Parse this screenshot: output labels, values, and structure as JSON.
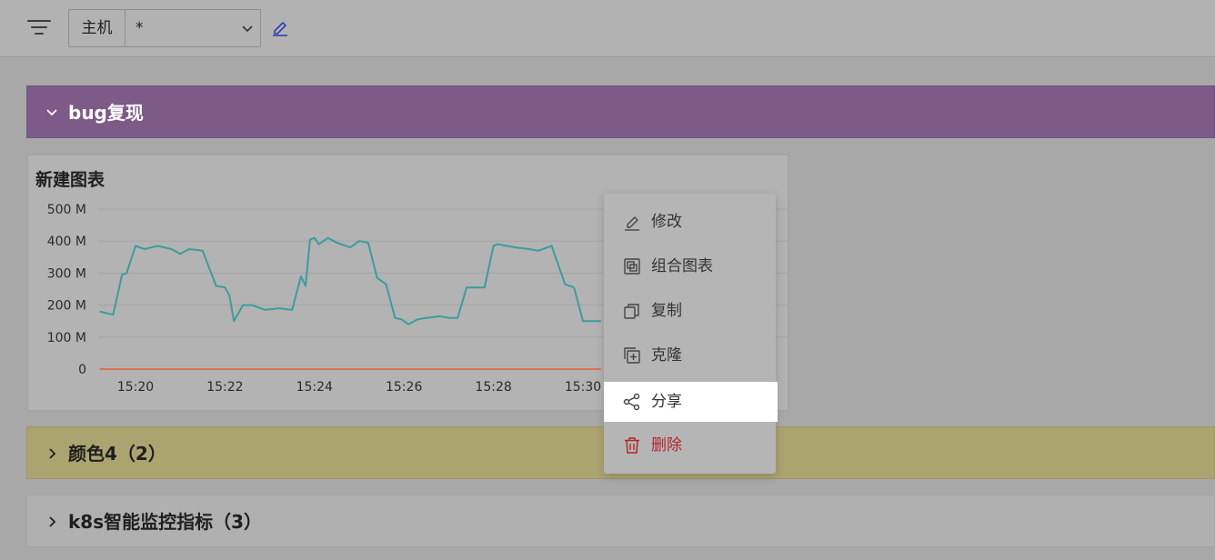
{
  "toolbar": {
    "variable_label": "主机",
    "variable_value": "*"
  },
  "rows": [
    {
      "title": "bug复现",
      "color": "#7d5a87"
    },
    {
      "title": "颜色4（2）",
      "color": "#aca470"
    },
    {
      "title": "k8s智能监控指标（3）",
      "color": "#b0b0b0"
    }
  ],
  "panel": {
    "title": "新建图表"
  },
  "chart_data": {
    "type": "line",
    "title": "新建图表",
    "xlabel": "",
    "ylabel": "",
    "ylim": [
      0,
      500
    ],
    "y_ticks": [
      "500 M",
      "400 M",
      "300 M",
      "200 M",
      "100 M",
      "0"
    ],
    "y_tick_values": [
      500,
      400,
      300,
      200,
      100,
      0
    ],
    "x_ticks": [
      "15:20",
      "15:22",
      "15:24",
      "15:26",
      "15:28",
      "15:30"
    ],
    "x_tick_values": [
      0,
      2,
      4,
      6,
      8,
      10
    ],
    "grid": true,
    "series": [
      {
        "color": "#3a9e9b",
        "x": [
          -0.8,
          -0.5,
          -0.3,
          -0.2,
          0.0,
          0.2,
          0.5,
          0.8,
          1.0,
          1.2,
          1.5,
          1.8,
          2.0,
          2.1,
          2.2,
          2.4,
          2.6,
          2.9,
          3.2,
          3.5,
          3.7,
          3.8,
          3.9,
          4.0,
          4.1,
          4.3,
          4.5,
          4.8,
          5.0,
          5.2,
          5.4,
          5.6,
          5.8,
          5.95,
          6.1,
          6.3,
          6.5,
          6.8,
          7.0,
          7.2,
          7.4,
          7.8,
          8.0,
          8.1,
          8.3,
          8.5,
          8.8,
          9.0,
          9.3,
          9.6,
          9.8,
          10.0,
          10.15,
          10.2,
          10.4
        ],
        "values": [
          180,
          170,
          295,
          300,
          385,
          375,
          385,
          375,
          360,
          375,
          370,
          260,
          255,
          230,
          150,
          200,
          200,
          185,
          190,
          185,
          290,
          260,
          405,
          410,
          390,
          410,
          395,
          380,
          400,
          395,
          285,
          265,
          160,
          155,
          140,
          155,
          160,
          165,
          160,
          160,
          255,
          255,
          385,
          390,
          385,
          380,
          375,
          370,
          385,
          265,
          255,
          150,
          150,
          150,
          150
        ]
      },
      {
        "color": "#d9734f",
        "x": [
          -0.8,
          10.4
        ],
        "values": [
          0,
          0
        ]
      }
    ]
  },
  "menu": {
    "items": [
      {
        "label": "修改",
        "icon": "edit-icon"
      },
      {
        "label": "组合图表",
        "icon": "combine-chart-icon"
      },
      {
        "label": "复制",
        "icon": "copy-icon"
      },
      {
        "label": "克隆",
        "icon": "clone-icon"
      },
      {
        "label": "分享",
        "icon": "share-icon"
      },
      {
        "label": "删除",
        "icon": "delete-icon"
      }
    ]
  }
}
